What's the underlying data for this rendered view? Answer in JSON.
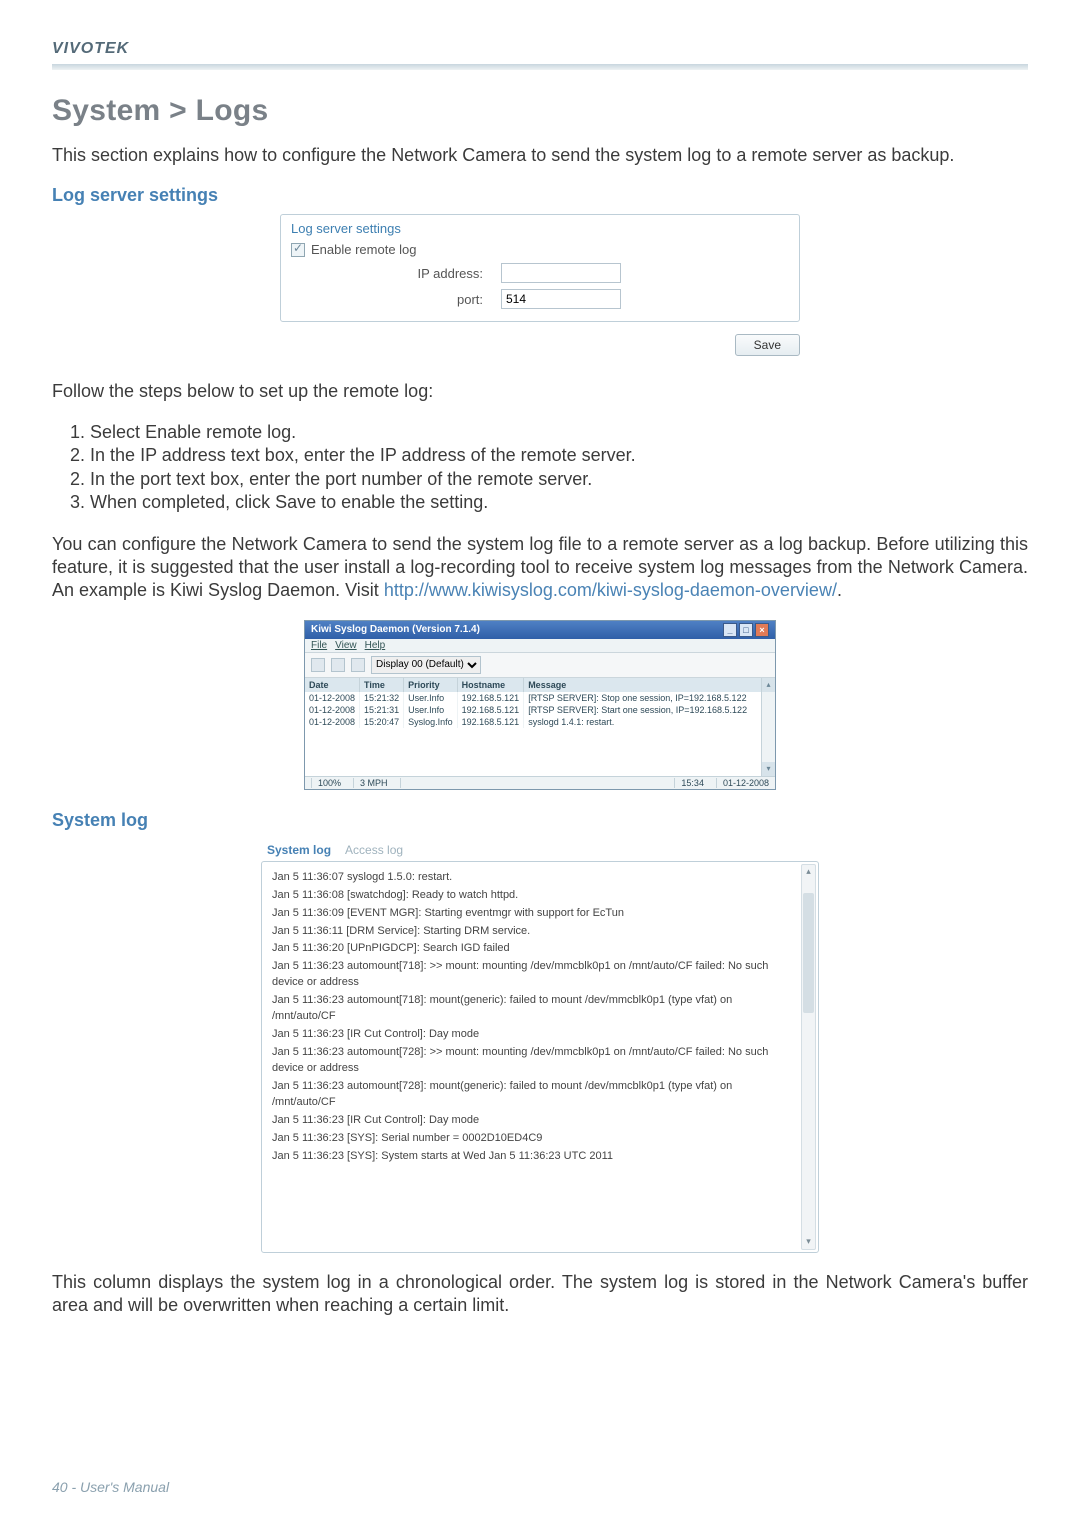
{
  "brand": "VIVOTEK",
  "page_title": "System > Logs",
  "intro": "This section explains how to configure the Network Camera to send the system log to a remote server as backup.",
  "sec1_title": "Log server settings",
  "panel": {
    "legend": "Log server settings",
    "enable_label": "Enable remote log",
    "ip_label": "IP address:",
    "ip_value": "",
    "port_label": "port:",
    "port_value": "514",
    "save_label": "Save"
  },
  "follow": "Follow the steps below to set up the remote log:",
  "steps": [
    {
      "n": "1",
      "pre": "Select ",
      "bold": "Enable remote log",
      "post": "."
    },
    {
      "n": "2",
      "pre": "In the IP address text box, enter the IP address of the remote server.",
      "bold": "",
      "post": ""
    },
    {
      "n": "2",
      "pre": "In the port text box, enter the port number of the remote server.",
      "bold": "",
      "post": ""
    },
    {
      "n": "3",
      "pre": "When completed, click ",
      "bold": "Save",
      "post": " to enable the setting."
    }
  ],
  "para2_pre": "You can configure the Network Camera to send the system log file to a remote server as a log backup. Before utilizing this feature, it is suggested that the user install a log-recording tool to receive system log messages from the Network Camera. An example is Kiwi Syslog Daemon. Visit ",
  "para2_link": "http://www.kiwisyslog.com/kiwi-syslog-daemon-overview/",
  "para2_post": ".",
  "kiwi": {
    "title": "Kiwi Syslog Daemon (Version 7.1.4)",
    "menu": [
      "File",
      "View",
      "Help"
    ],
    "display_label": "Display 00 (Default)",
    "headers": [
      "Date",
      "Time",
      "Priority",
      "Hostname",
      "Message"
    ],
    "rows": [
      [
        "01-12-2008",
        "15:21:32",
        "User.Info",
        "192.168.5.121",
        "[RTSP SERVER]: Stop one session, IP=192.168.5.122"
      ],
      [
        "01-12-2008",
        "15:21:31",
        "User.Info",
        "192.168.5.121",
        "[RTSP SERVER]: Start one session, IP=192.168.5.122"
      ],
      [
        "01-12-2008",
        "15:20:47",
        "Syslog.Info",
        "192.168.5.121",
        "syslogd 1.4.1: restart."
      ]
    ],
    "status": {
      "pct": "100%",
      "rate": "3 MPH",
      "time": "15:34",
      "date": "01-12-2008"
    }
  },
  "sec2_title": "System log",
  "syslog": {
    "tab_active": "System log",
    "tab_other": "Access log",
    "lines": [
      "Jan 5 11:36:07 syslogd 1.5.0: restart.",
      "Jan 5 11:36:08 [swatchdog]: Ready to watch httpd.",
      "Jan 5 11:36:09 [EVENT MGR]: Starting eventmgr with support for EcTun",
      "Jan 5 11:36:11 [DRM Service]: Starting DRM service.",
      "Jan 5 11:36:20 [UPnPIGDCP]: Search IGD failed",
      "Jan 5 11:36:23 automount[718]: >> mount: mounting /dev/mmcblk0p1 on /mnt/auto/CF failed: No such device or address",
      "Jan 5 11:36:23 automount[718]: mount(generic): failed to mount /dev/mmcblk0p1 (type vfat) on /mnt/auto/CF",
      "Jan 5 11:36:23 [IR Cut Control]: Day mode",
      "Jan 5 11:36:23 automount[728]: >> mount: mounting /dev/mmcblk0p1 on /mnt/auto/CF failed: No such device or address",
      "Jan 5 11:36:23 automount[728]: mount(generic): failed to mount /dev/mmcblk0p1 (type vfat) on /mnt/auto/CF",
      "Jan 5 11:36:23 [IR Cut Control]: Day mode",
      "Jan 5 11:36:23 [SYS]: Serial number = 0002D10ED4C9",
      "Jan 5 11:36:23 [SYS]: System starts at Wed Jan 5 11:36:23 UTC 2011"
    ]
  },
  "closing": "This column displays the system log in a chronological order. The system log is stored in the Network Camera's buffer area and will be overwritten when reaching a certain limit.",
  "footer": "40 - User's Manual"
}
